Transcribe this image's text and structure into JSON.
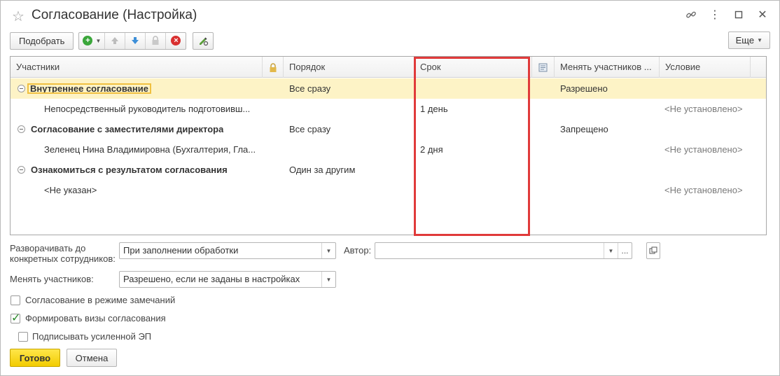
{
  "window": {
    "title": "Согласование (Настройка)"
  },
  "toolbar": {
    "pick_label": "Подобрать",
    "more_label": "Еще"
  },
  "table": {
    "headers": {
      "participants": "Участники",
      "order": "Порядок",
      "term": "Срок",
      "change_participants": "Менять участников ...",
      "condition": "Условие"
    },
    "rows": [
      {
        "participants": "Внутреннее согласование",
        "order": "Все сразу",
        "term": "",
        "change": "Разрешено",
        "condition": ""
      },
      {
        "participants": "Непосредственный руководитель подготовивш...",
        "order": "",
        "term": "1 день",
        "change": "",
        "condition": "<Не установлено>"
      },
      {
        "participants": "Согласование с заместителями директора",
        "order": "Все сразу",
        "term": "",
        "change": "Запрещено",
        "condition": ""
      },
      {
        "participants": "Зеленец Нина Владимировна (Бухгалтерия, Гла...",
        "order": "",
        "term": "2 дня",
        "change": "",
        "condition": "<Не установлено>"
      },
      {
        "participants": "Ознакомиться с результатом согласования",
        "order": "Один за другим",
        "term": "",
        "change": "",
        "condition": ""
      },
      {
        "participants": "<Не указан>",
        "order": "",
        "term": "",
        "change": "",
        "condition": "<Не установлено>"
      }
    ]
  },
  "form": {
    "expand_label_line1": "Разворачивать до",
    "expand_label_line2": "конкретных сотрудников:",
    "expand_value": "При заполнении обработки",
    "author_label": "Автор:",
    "author_value": "",
    "change_label": "Менять участников:",
    "change_value": "Разрешено, если не заданы в настройках",
    "checkbox_remarks": "Согласование в режиме замечаний",
    "checkbox_visas": "Формировать визы согласования",
    "checkbox_sign": "Подписывать усиленной ЭП",
    "checkbox_remarks_checked": false,
    "checkbox_visas_checked": true,
    "checkbox_sign_checked": false
  },
  "footer": {
    "ok_label": "Готово",
    "cancel_label": "Отмена"
  }
}
